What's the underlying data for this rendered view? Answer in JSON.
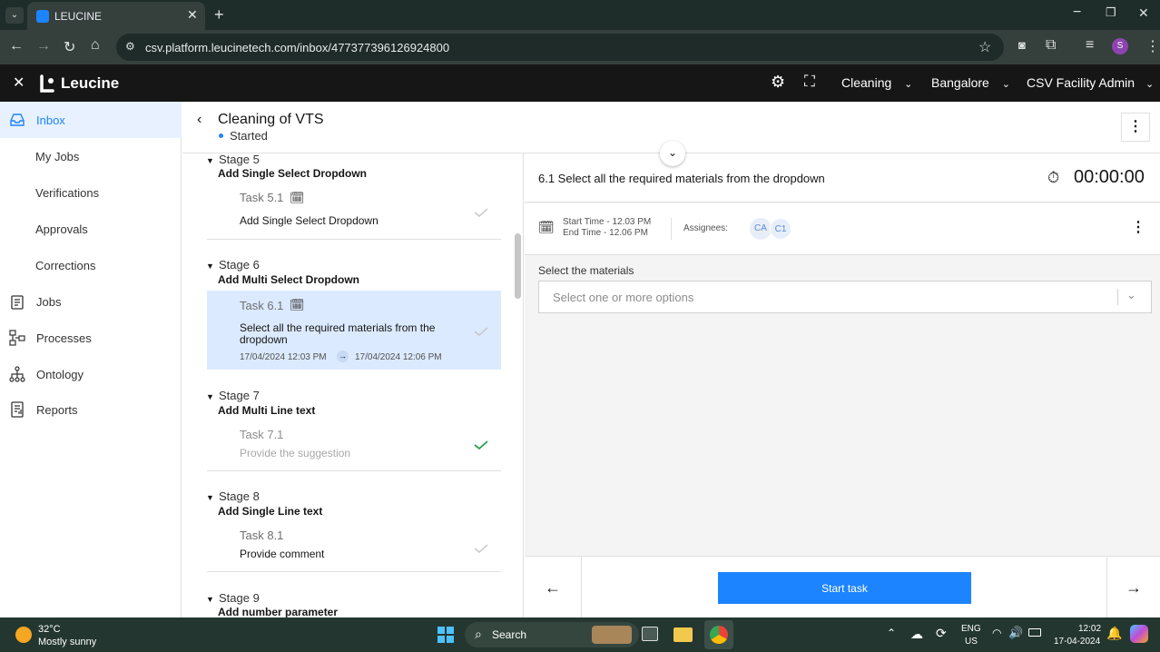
{
  "browser": {
    "tab_title": "LEUCINE",
    "url": "csv.platform.leucinetech.com/inbox/477377396126924800",
    "profile_initial": "S"
  },
  "app": {
    "brand": "Leucine",
    "menus": [
      "Cleaning",
      "Bangalore",
      "CSV Facility Admin"
    ]
  },
  "sidebar": {
    "items": [
      {
        "label": "Inbox"
      },
      {
        "label": "My Jobs"
      },
      {
        "label": "Verifications"
      },
      {
        "label": "Approvals"
      },
      {
        "label": "Corrections"
      },
      {
        "label": "Jobs"
      },
      {
        "label": "Processes"
      },
      {
        "label": "Ontology"
      },
      {
        "label": "Reports"
      }
    ]
  },
  "job": {
    "title": "Cleaning of VTS",
    "status": "Started"
  },
  "stages": [
    {
      "stage": "Stage 5",
      "name": "Add Single Select Dropdown",
      "task": "Task 5.1",
      "desc": "Add Single Select Dropdown"
    },
    {
      "stage": "Stage 6",
      "name": "Add Multi Select Dropdown",
      "task": "Task 6.1",
      "desc": "Select all the required materials from the dropdown",
      "start": "17/04/2024 12:03 PM",
      "end": "17/04/2024 12:06 PM"
    },
    {
      "stage": "Stage 7",
      "name": "Add Multi Line text",
      "task": "Task 7.1",
      "desc": "Provide the suggestion"
    },
    {
      "stage": "Stage 8",
      "name": "Add Single Line text",
      "task": "Task 8.1",
      "desc": "Provide comment"
    },
    {
      "stage": "Stage 9",
      "name": "Add number parameter"
    }
  ],
  "task_detail": {
    "title": "6.1 Select all the required materials from the dropdown",
    "timer": "00:00:00",
    "start_time": "Start Time - 12.03 PM",
    "end_time": "End Time - 12.06 PM",
    "assignees_label": "Assignees:",
    "assignees": [
      "CA",
      "C1"
    ],
    "field_label": "Select the materials",
    "field_placeholder": "Select one or more options",
    "start_button": "Start task"
  },
  "taskbar": {
    "temp": "32°C",
    "weather": "Mostly sunny",
    "search": "Search",
    "lang1": "ENG",
    "lang2": "US",
    "time": "12:02",
    "date": "17-04-2024"
  },
  "colors": {
    "primary": "#1d84ff",
    "selected_bg": "#dbeafe",
    "success": "#24a148"
  }
}
